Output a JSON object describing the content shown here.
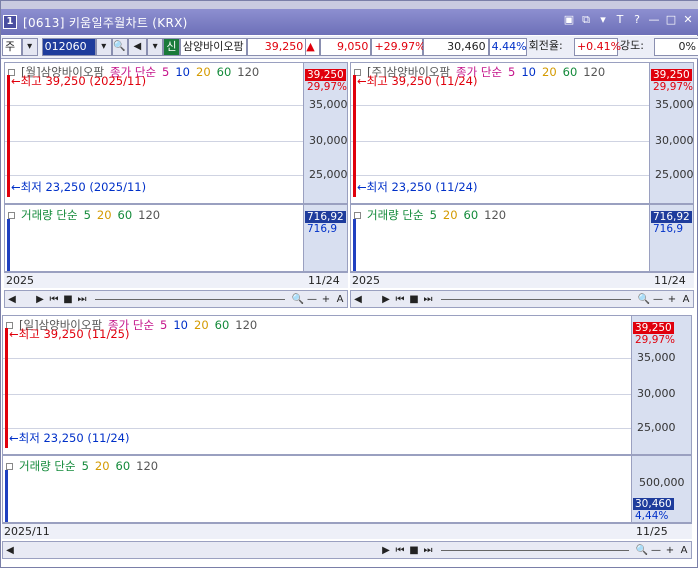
{
  "window": {
    "number": "1",
    "title": "[0613] 키움일주월차트 (KRX)"
  },
  "toolbar": {
    "period": "주",
    "code": "012060",
    "market": "신",
    "name": "삼양바이오팜",
    "price": "39,250",
    "change": "9,050",
    "change_pct": "+29.97%",
    "volume": "30,460",
    "vol_pct": "4.44%",
    "turnover_label": "회전율:",
    "turnover": "+0.41%",
    "strength_label": "강도:",
    "strength": "0%"
  },
  "panes": {
    "week": {
      "header": "[월]삼양바이오팜",
      "close_label": "종가 단순",
      "ma": [
        "5",
        "10",
        "20",
        "60",
        "120"
      ],
      "high_label": "최고 39,250 (2025/11)",
      "low_label": "최저 23,250 (2025/11)",
      "ticks": [
        "35,000",
        "30,000",
        "25,000"
      ],
      "tag_top": "39,250",
      "tag_pct": "29,97%",
      "vol_label": "거래량 단순",
      "vol_ma": [
        "5",
        "20",
        "60",
        "120"
      ],
      "vol_tag": "716,92",
      "vol_tag2": "716,9",
      "x_left": "2025",
      "x_right": "11/24"
    },
    "month": {
      "header": "[주]삼양바이오팜",
      "close_label": "종가 단순",
      "ma": [
        "5",
        "10",
        "20",
        "60",
        "120"
      ],
      "high_label": "최고 39,250 (11/24)",
      "low_label": "최저 23,250 (11/24)",
      "ticks": [
        "35,000",
        "30,000",
        "25,000"
      ],
      "tag_top": "39,250",
      "tag_pct": "29,97%",
      "vol_label": "거래량 단순",
      "vol_ma": [
        "5",
        "20",
        "60",
        "120"
      ],
      "vol_tag": "716,92",
      "vol_tag2": "716,9",
      "x_left": "2025",
      "x_right": "11/24"
    },
    "day": {
      "header": "[일]삼양바이오팜",
      "close_label": "종가 단순",
      "ma": [
        "5",
        "10",
        "20",
        "60",
        "120"
      ],
      "high_label": "최고 39,250 (11/25)",
      "low_label": "최저 23,250 (11/24)",
      "ticks": [
        "35,000",
        "30,000",
        "25,000"
      ],
      "tag_top": "39,250",
      "tag_pct": "29,97%",
      "vol_label": "거래량 단순",
      "vol_ma": [
        "5",
        "20",
        "60",
        "120"
      ],
      "vol_ticks": [
        "500,000"
      ],
      "vol_tag": "30,460",
      "vol_pct": "4,44%",
      "x_left": "2025/11",
      "x_right": "11/25"
    }
  },
  "controls": [
    "◀",
    "▶",
    "⏮",
    "■",
    "⏭",
    "🔍",
    "—",
    "+",
    "A"
  ],
  "colors": {
    "title": "#7275bf",
    "price_up": "#e0000c",
    "price_down": "#0030c8",
    "axis_bg": "#d8dff0"
  }
}
